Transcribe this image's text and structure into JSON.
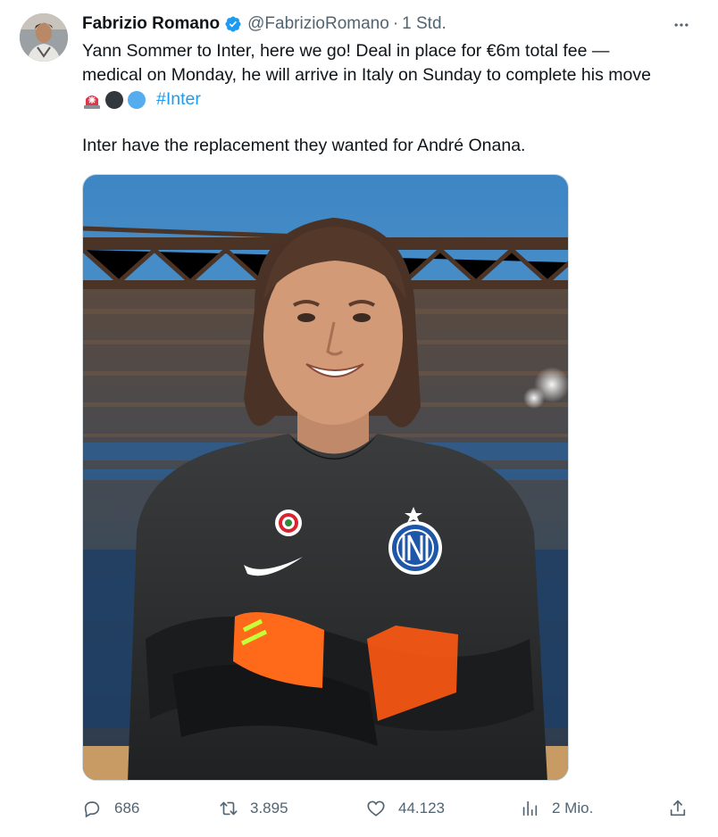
{
  "author": {
    "name": "Fabrizio Romano",
    "handle": "@FabrizioRomano",
    "separator": "·",
    "time": "1 Std."
  },
  "tweet": {
    "line1": "Yann Sommer to Inter, here we go! Deal in place for €6m total fee —",
    "line2": "medical on Monday, he will arrive in Italy on Sunday to complete his move",
    "hashtag": "#Inter",
    "line3": "Inter have the replacement they wanted for André Onana."
  },
  "emojis": [
    "siren-emoji",
    "black-circle-emoji",
    "blue-circle-emoji"
  ],
  "actions": {
    "replies": "686",
    "retweets": "3.895",
    "likes": "44.123",
    "views": "2 Mio."
  },
  "colors": {
    "accent": "#1d9bf0",
    "secondary_text": "#536471",
    "primary_text": "#0f1419"
  }
}
